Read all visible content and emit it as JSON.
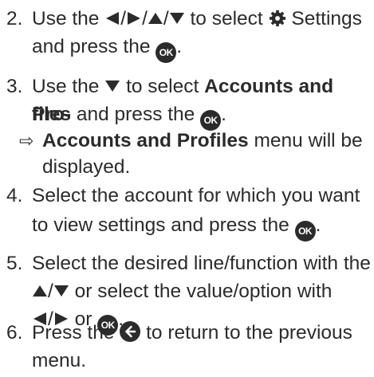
{
  "steps": [
    {
      "number": "2.",
      "line1_pre": "Use the",
      "line1_post": "to select",
      "line1_target": "Settings",
      "line2_pre": "and press the",
      "line2_post": "."
    },
    {
      "number": "3.",
      "line1_pre": "Use the",
      "line1_mid": "to select",
      "line1_bold": "Accounts and Pro-",
      "line2_bold": "files",
      "line2_pre": "and press the",
      "line2_post": "."
    },
    {
      "result_arrow": "⇨",
      "result_bold": "Accounts and Profiles",
      "result_line1_post": "menu will be",
      "result_line2": "displayed."
    },
    {
      "number": "4.",
      "line1": "Select the account for which you want",
      "line2_pre": "to view settings and press the",
      "line2_post": "."
    },
    {
      "number": "5.",
      "line1": "Select the desired line/function with the",
      "line2_post": "or select the value/option with",
      "line3_mid": "or",
      "line3_post": "."
    },
    {
      "number": "6.",
      "line1_pre": "Press the",
      "line1_post": "to return to the previous",
      "line2": "menu."
    }
  ],
  "icons": {
    "ok_label": "OK",
    "slash": "/",
    "left": "left-arrow-icon",
    "right": "right-arrow-icon",
    "up": "up-arrow-icon",
    "down": "down-arrow-icon",
    "settings": "gear-icon",
    "back": "back-icon"
  }
}
